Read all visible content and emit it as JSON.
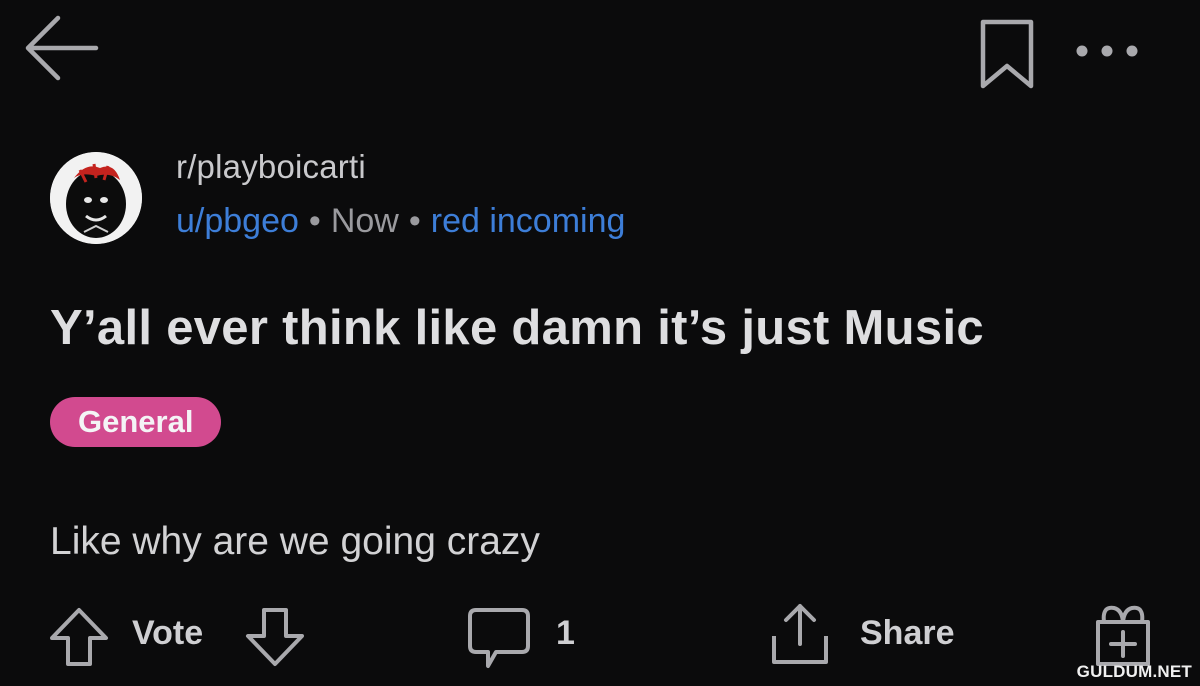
{
  "topbar": {
    "back_icon": "arrow-left-icon",
    "bookmark_icon": "bookmark-icon",
    "more_icon": "more-horizontal-icon"
  },
  "post": {
    "subreddit": "r/playboicarti",
    "author": "u/pbgeo",
    "separator": "•",
    "time": "Now",
    "user_flair": "red incoming",
    "title": "Y’all ever think like damn it’s just Music",
    "tag": "General",
    "body": "Like why are we going crazy"
  },
  "actions": {
    "vote_label": "Vote",
    "comment_count": "1",
    "share_label": "Share",
    "upvote_icon": "arrow-up-icon",
    "downvote_icon": "arrow-down-icon",
    "comment_icon": "comment-bubble-icon",
    "share_icon": "share-upload-icon",
    "award_icon": "gift-award-icon"
  },
  "watermark": "GULDUM.NET",
  "colors": {
    "background": "#0b0b0c",
    "link_blue": "#3d7ed8",
    "tag_pink": "#d24a8f",
    "text": "#d8d8da",
    "muted": "#9a9a9e"
  }
}
